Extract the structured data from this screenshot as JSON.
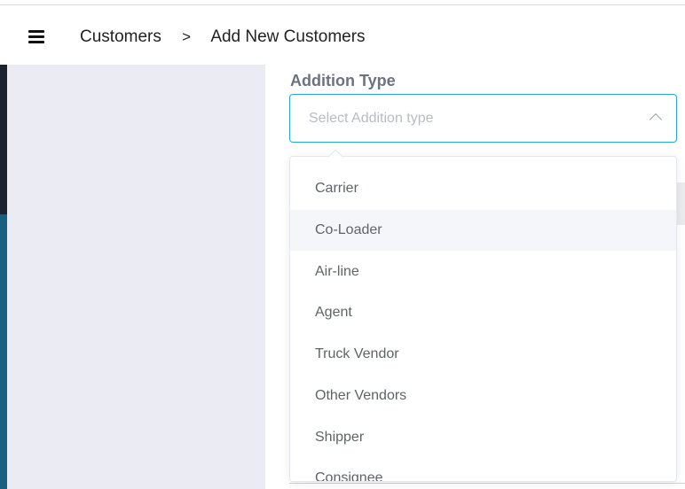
{
  "breadcrumb": {
    "root": "Customers",
    "separator": ">",
    "current": "Add New Customers"
  },
  "form": {
    "addition_type": {
      "label": "Addition Type",
      "placeholder": "Select Addition type"
    }
  },
  "dropdown": {
    "hovered_index": 1,
    "options": [
      "Carrier",
      "Co-Loader",
      "Air-line",
      "Agent",
      "Truck Vendor",
      "Other Vendors",
      "Shipper",
      "Consignee"
    ]
  },
  "icons": {
    "menu": "hamburger-menu-icon",
    "select_toggle": "chevron-up-icon"
  },
  "colors": {
    "accent": "#2aa7d1",
    "sidebar_dark": "#1c2230",
    "sidebar_accent": "#17607f",
    "panel_bg": "#ebebf4"
  }
}
